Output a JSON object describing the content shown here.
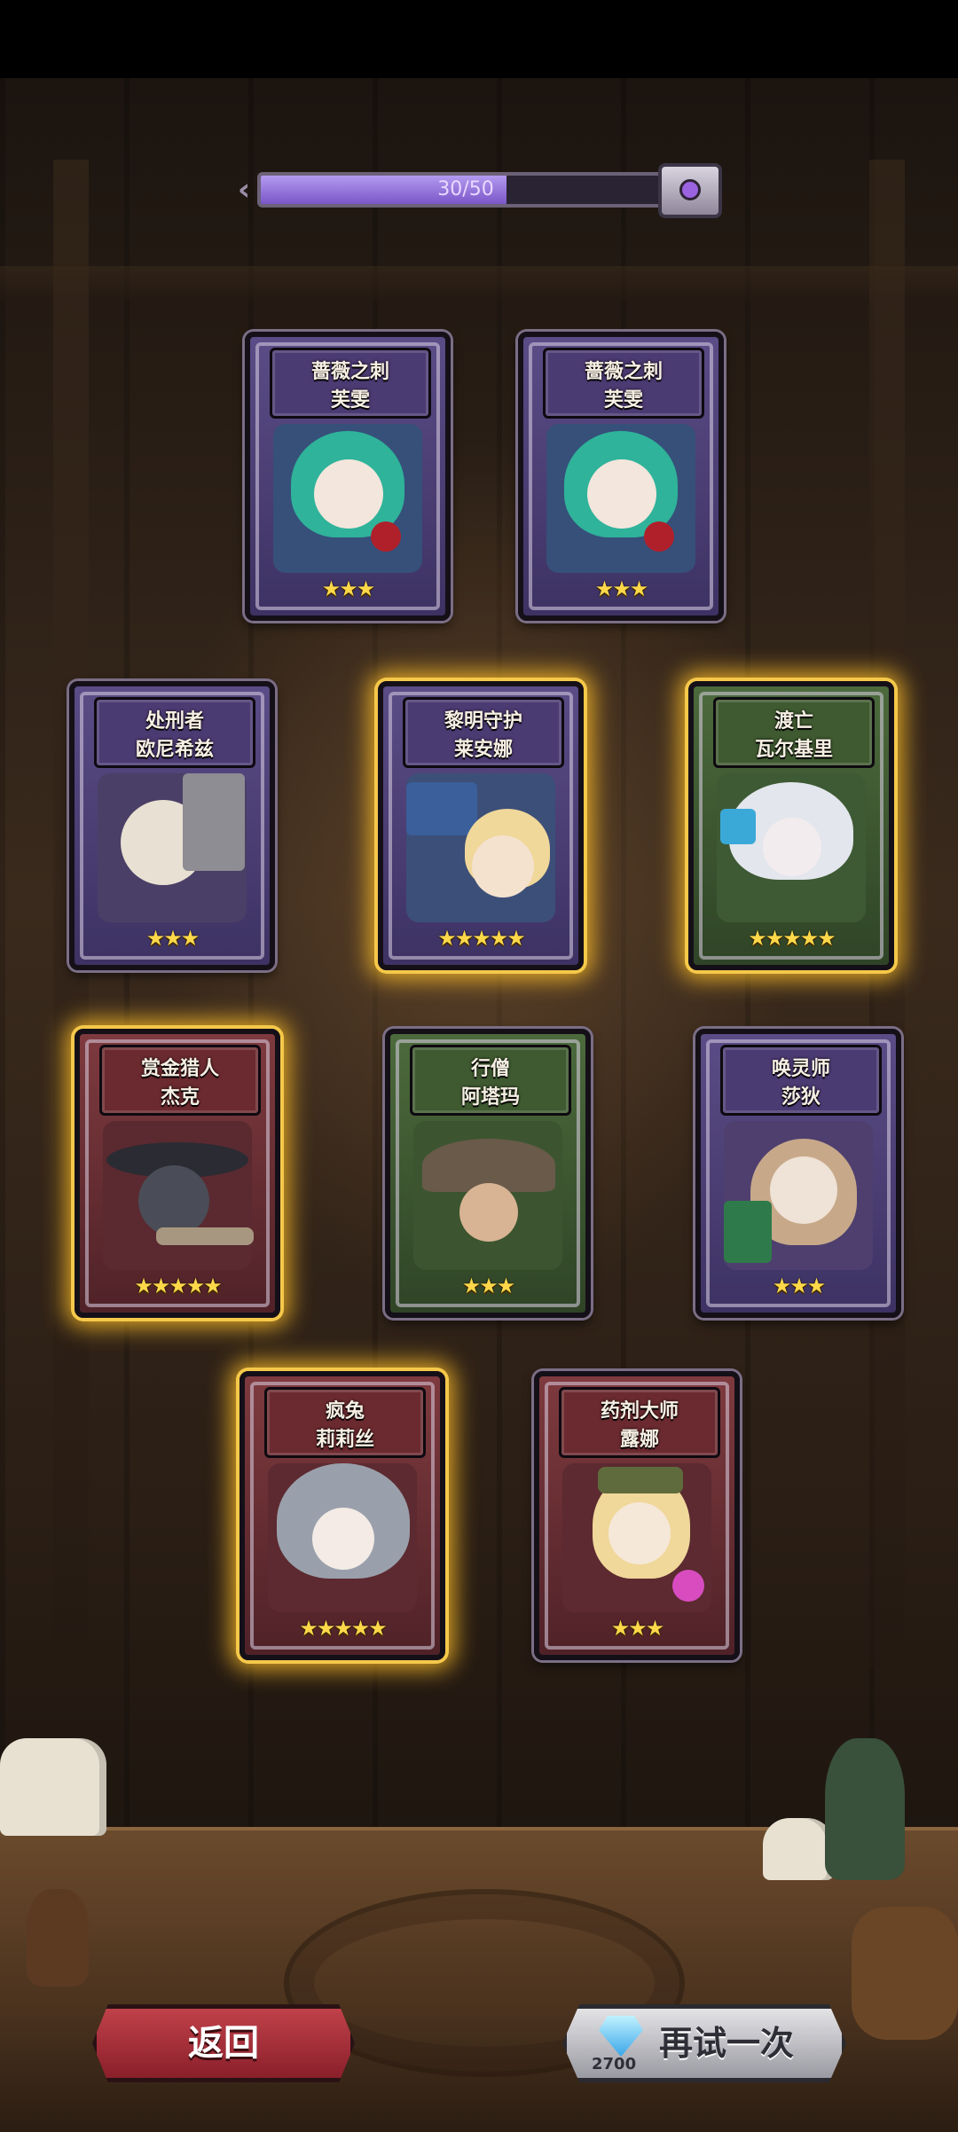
{
  "progress": {
    "text": "30/50",
    "current": 30,
    "max": 50
  },
  "cards": [
    {
      "title": "蔷薇之刺",
      "name": "芙雯",
      "stars": "★★★",
      "theme": "purple",
      "glow": false
    },
    {
      "title": "蔷薇之刺",
      "name": "芙雯",
      "stars": "★★★",
      "theme": "purple",
      "glow": false
    },
    {
      "title": "处刑者",
      "name": "欧尼希兹",
      "stars": "★★★",
      "theme": "purple",
      "glow": false
    },
    {
      "title": "黎明守护",
      "name": "莱安娜",
      "stars": "★★★★★",
      "theme": "purple",
      "glow": true
    },
    {
      "title": "渡亡",
      "name": "瓦尔基里",
      "stars": "★★★★★",
      "theme": "green",
      "glow": true
    },
    {
      "title": "赏金猎人",
      "name": "杰克",
      "stars": "★★★★★",
      "theme": "crimson",
      "glow": true
    },
    {
      "title": "行僧",
      "name": "阿塔玛",
      "stars": "★★★",
      "theme": "green",
      "glow": false
    },
    {
      "title": "唤灵师",
      "name": "莎狄",
      "stars": "★★★",
      "theme": "purple",
      "glow": false
    },
    {
      "title": "疯兔",
      "name": "莉莉丝",
      "stars": "★★★★★",
      "theme": "crimson",
      "glow": true
    },
    {
      "title": "药剂大师",
      "name": "露娜",
      "stars": "★★★",
      "theme": "crimson",
      "glow": false
    }
  ],
  "buttons": {
    "back_label": "返回",
    "retry_label": "再试一次",
    "retry_cost": "2700",
    "cost_icon": "diamond-icon"
  },
  "colors": {
    "accent_gold": "#f5c84a",
    "progress_fill": "#9b7be0",
    "back_button": "#b3343d"
  }
}
